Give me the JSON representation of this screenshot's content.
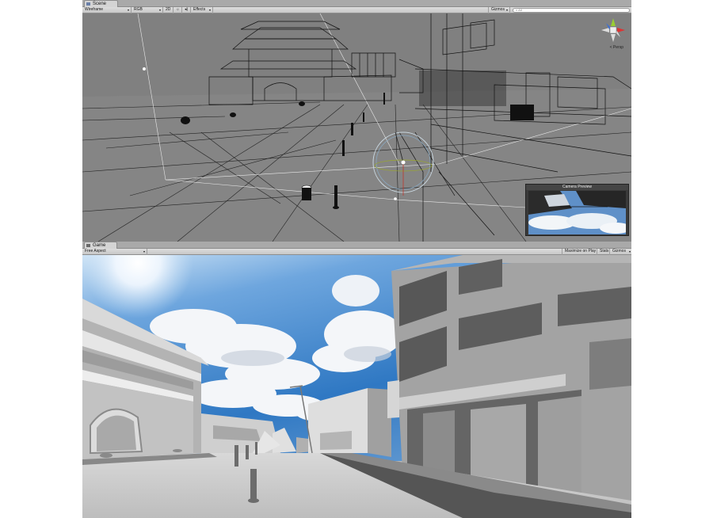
{
  "scene": {
    "tab_label": "Scene",
    "toolbar": {
      "render_mode": "Wireframe",
      "color_mode": "RGB",
      "mode_2d": "2D",
      "effects": "Effects",
      "gizmos": "Gizmos",
      "search_placeholder": "All"
    },
    "persp_label": "< Persp",
    "camera_preview_title": "Camera Preview"
  },
  "game": {
    "tab_label": "Game",
    "toolbar": {
      "aspect": "Free Aspect",
      "maximize_on_play": "Maximize on Play",
      "stats": "Stats",
      "gizmos": "Gizmos"
    }
  },
  "colors": {
    "editor_chrome": "#c2c2c2",
    "scene_background": "#828282",
    "wireframe": "#111111",
    "sky": "#3d7fc6"
  },
  "icons": [
    "scene-tab-icon",
    "game-tab-icon",
    "light-toggle-icon",
    "audio-toggle-icon",
    "scene-gizmo-icon"
  ]
}
